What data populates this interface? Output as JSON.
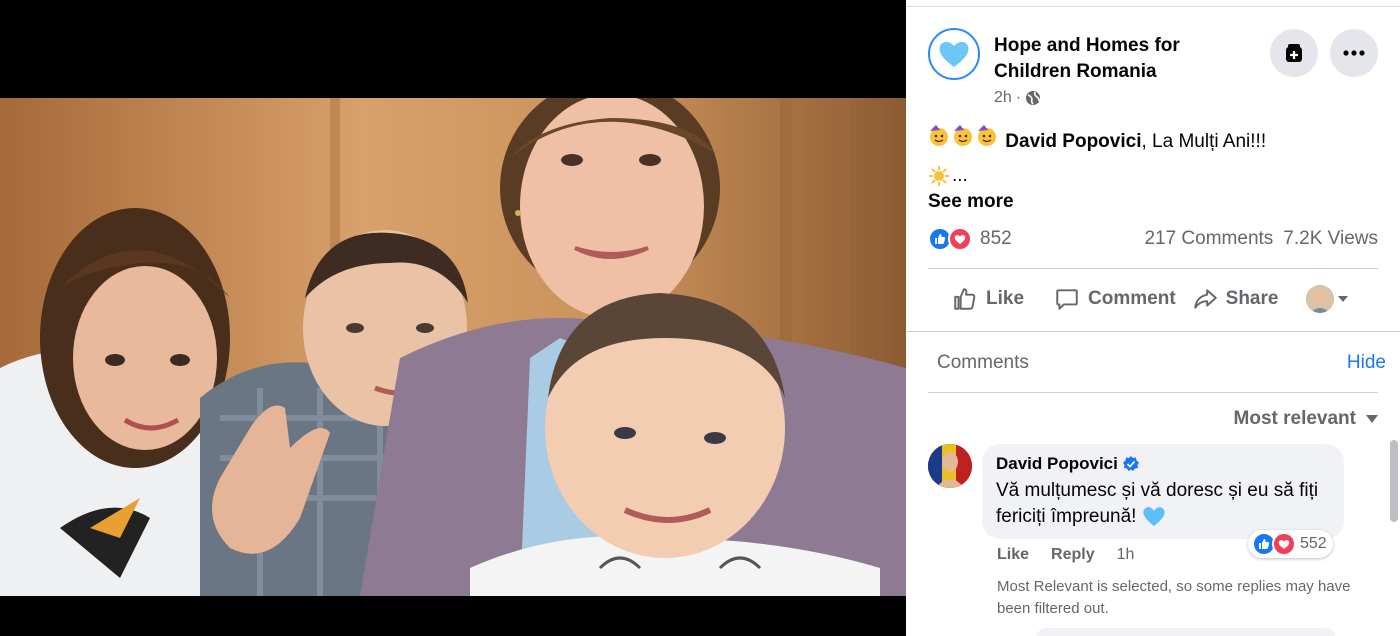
{
  "post": {
    "page_name": "Hope and Homes for Children Romania",
    "time": "2h",
    "separator": "·",
    "privacy_icon": "globe-icon",
    "text_mention": "David Popovici",
    "text_body": ", La Mulți Ani!!!",
    "ellipsis": "...",
    "see_more": "See more",
    "reaction_count": "852",
    "comments_count": "217 Comments",
    "views_count": "7.2K Views"
  },
  "actions": {
    "like": "Like",
    "comment": "Comment",
    "share": "Share"
  },
  "comments": {
    "label": "Comments",
    "hide": "Hide",
    "sort": "Most relevant",
    "items": [
      {
        "author": "David Popovici",
        "text": "Vă mulțumesc și vă doresc și eu să fiți fericiți împreună!",
        "like": "Like",
        "reply": "Reply",
        "time": "1h",
        "reaction_count": "552"
      }
    ],
    "filter_note": "Most Relevant is selected, so some replies may have been filtered out."
  },
  "colors": {
    "accent": "#1877f2",
    "secondary_text": "#65676b",
    "love": "#f33e58",
    "heart_emoji": "#5bc0f8"
  }
}
